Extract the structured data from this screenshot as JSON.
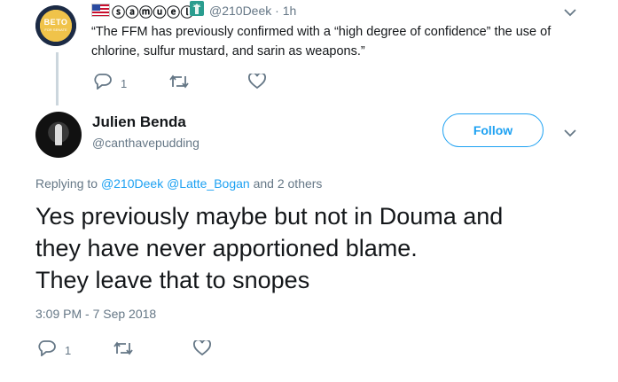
{
  "parent_tweet": {
    "display_name": "𝕠𝕠𝕠𝕠𝕠𝕠",
    "display_name_text": "ⓢⓐⓜⓤⓔⓛ",
    "handle_time": "@210Deek · 1h",
    "text": "“The FFM has previously confirmed with a “high degree of confidence” the use of chlorine, sulfur mustard, and sarin as weapons.”",
    "avatar_text": "BETO",
    "avatar_subtext": "FOR SENATE",
    "reply_count": "1",
    "retweet_count": "",
    "like_count": "",
    "icons": [
      "us-flag-icon",
      "statue-of-liberty-icon",
      "chevron-down-icon",
      "reply-icon",
      "retweet-icon",
      "like-icon"
    ]
  },
  "main_tweet": {
    "display_name": "Julien Benda",
    "handle": "@canthavepudding",
    "follow_label": "Follow",
    "replying_prefix": "Replying to",
    "replying_mentions": "@210Deek @Latte_Bogan",
    "replying_suffix": "and 2 others",
    "text_line1": "Yes previously maybe but not in Douma and",
    "text_line2": "they have never apportioned blame.",
    "text_line3": "They leave that to snopes",
    "timestamp": "3:09 PM - 7 Sep 2018",
    "reply_count": "1",
    "retweet_count": "",
    "like_count": ""
  },
  "colors": {
    "accent": "#1da1f2",
    "secondary_text": "#657786",
    "primary_text": "#14171a",
    "thread_line": "#ccd6dd"
  }
}
